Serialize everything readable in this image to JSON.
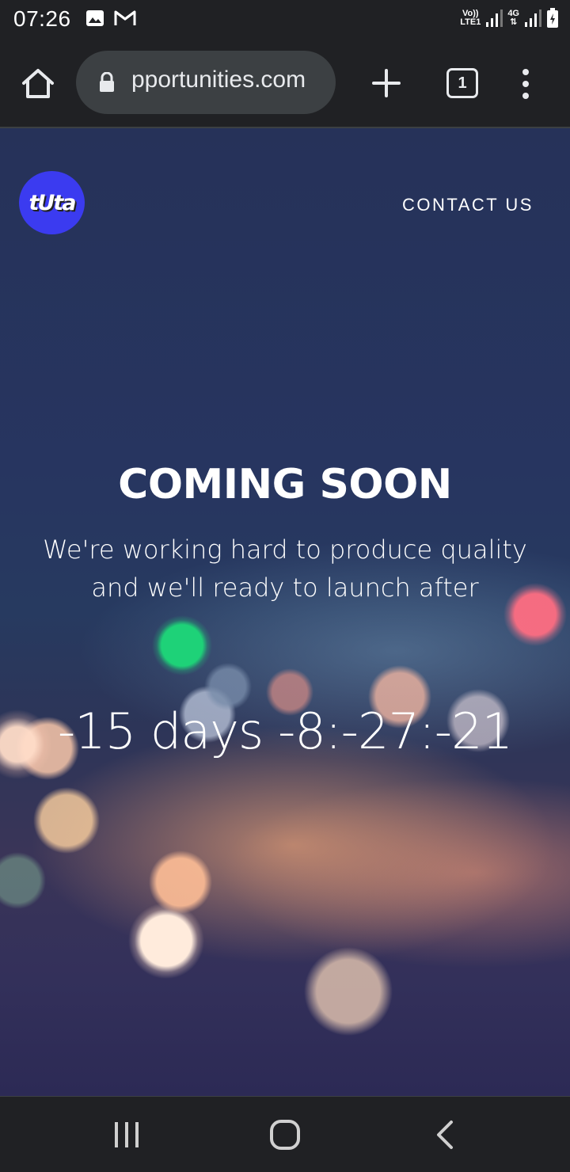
{
  "status_bar": {
    "time": "07:26",
    "left_icons": [
      "image-icon",
      "gmail-icon"
    ],
    "volte_label": "Vo))",
    "lte_label": "LTE1",
    "network_label": "4G",
    "right_icons": [
      "signal-icon",
      "signal-icon",
      "battery-charging-icon"
    ]
  },
  "browser": {
    "url": "pportunities.com",
    "tab_count": "1",
    "icons": [
      "home-icon",
      "lock-icon",
      "plus-icon",
      "tabs-icon",
      "more-vert-icon"
    ]
  },
  "page": {
    "logo_text": "tUta",
    "nav_link": "CONTACT US",
    "headline": "COMING SOON",
    "subtext_line1": "We're working hard to produce quality",
    "subtext_line2": "and we'll ready to launch after",
    "countdown": "-15 days -8:-27:-21",
    "colors": {
      "logo_bg": "#3b3bf0",
      "page_bg": "#273560",
      "text": "#ffffff"
    }
  },
  "navigation_bar": {
    "icons": [
      "recents-icon",
      "home-circle-icon",
      "back-icon"
    ]
  }
}
